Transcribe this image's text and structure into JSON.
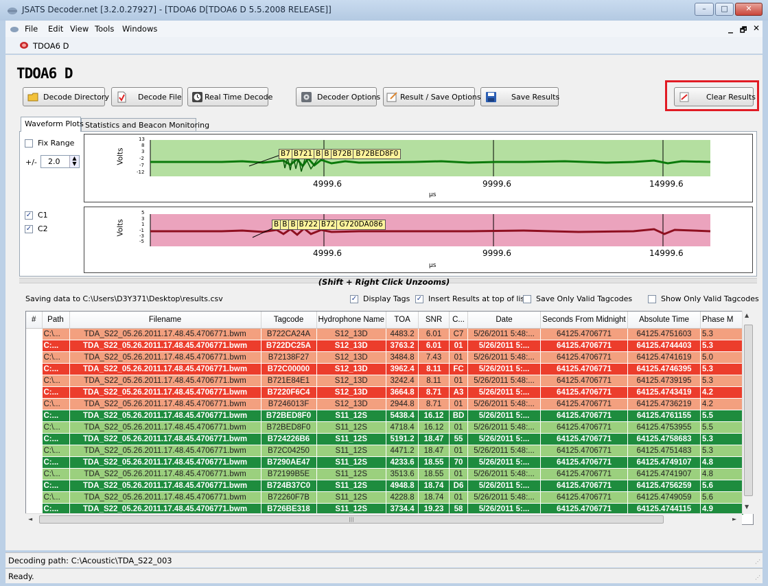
{
  "window": {
    "title": "JSATS Decoder.net [3.2.0.27927] - [TDOA6 D[TDOA6 D 5.5.2008 RELEASE]]",
    "minimize": "–",
    "maximize": "□",
    "close": "✕"
  },
  "menu": {
    "items": [
      "File",
      "Edit",
      "View",
      "Tools",
      "Windows"
    ],
    "mdi_minimize": "_",
    "mdi_restore": "🗗",
    "mdi_close": "✕"
  },
  "document_tab": {
    "title": "TDOA6 D"
  },
  "heading": "TDOA6 D",
  "toolbar": {
    "decode_directory": "Decode Directory",
    "decode_file": "Decode File",
    "real_time_decode": "Real Time Decode",
    "decoder_options": "Decoder Options",
    "result_save_options": "Result / Save Options",
    "save_results": "Save Results",
    "clear_results": "Clear Results"
  },
  "tabs": [
    "Waveform Plots",
    "Statistics and Beacon Monitoring"
  ],
  "controls": {
    "fix_range": "Fix Range",
    "plus_minus": "+/-",
    "range_value": "2.0",
    "c1": "C1",
    "c2": "C2"
  },
  "plot1": {
    "ylabel": "Volts",
    "xlabel": "µs",
    "yticks": [
      "13",
      "8",
      "3",
      "-2",
      "-7",
      "-12"
    ],
    "xticks": [
      "4999.6",
      "9999.6",
      "14999.6"
    ],
    "tags": [
      "B7",
      "B721",
      "B",
      "B",
      "B72B",
      "B72BED8F0"
    ],
    "color": "#00a000"
  },
  "plot2": {
    "ylabel": "Volts",
    "xlabel": "µs",
    "yticks": [
      "5",
      "3",
      "1",
      "-1",
      "-3",
      "-5"
    ],
    "xticks": [
      "4999.6",
      "9999.6",
      "14999.6"
    ],
    "tags": [
      "B",
      "B",
      "B",
      "B722",
      "B72",
      "G720DA086"
    ],
    "color": "#b0102a"
  },
  "unzoom_hint": "(Shift + Right Click Unzooms)",
  "options": {
    "saving_to": "Saving data to C:\\Users\\D3Y371\\Desktop\\results.csv",
    "display_tags": "Display Tags",
    "insert_top": "Insert Results at top of list",
    "save_only_valid": "Save Only Valid Tagcodes",
    "show_only_valid": "Show Only Valid Tagcodes"
  },
  "table": {
    "columns": [
      "#",
      "Path",
      "Filename",
      "Tagcode",
      "Hydrophone Name",
      "TOA",
      "SNR",
      "C...",
      "Date",
      "Seconds From Midnight",
      "Absolute Time",
      "Phase M"
    ],
    "rows": [
      {
        "style": "ls",
        "cells": [
          "",
          "C:\\...",
          "TDA_S22_05.26.2011.17.48.45.4706771.bwm",
          "B722CA24A",
          "S12_13D",
          "4483.2",
          "6.01",
          "C7",
          "5/26/2011 5:48:...",
          "64125.4706771",
          "64125.4751603",
          "5.3"
        ]
      },
      {
        "style": "ds",
        "cells": [
          "",
          "C:...",
          "TDA_S22_05.26.2011.17.48.45.4706771.bwm",
          "B722DC25A",
          "S12_13D",
          "3763.2",
          "6.01",
          "01",
          "5/26/2011 5:...",
          "64125.4706771",
          "64125.4744403",
          "5.3"
        ]
      },
      {
        "style": "ls",
        "cells": [
          "",
          "C:\\...",
          "TDA_S22_05.26.2011.17.48.45.4706771.bwm",
          "B72138F27",
          "S12_13D",
          "3484.8",
          "7.43",
          "01",
          "5/26/2011 5:48:...",
          "64125.4706771",
          "64125.4741619",
          "5.0"
        ]
      },
      {
        "style": "ds",
        "cells": [
          "",
          "C:...",
          "TDA_S22_05.26.2011.17.48.45.4706771.bwm",
          "B72C00000",
          "S12_13D",
          "3962.4",
          "8.11",
          "FC",
          "5/26/2011 5:...",
          "64125.4706771",
          "64125.4746395",
          "5.3"
        ]
      },
      {
        "style": "ls",
        "cells": [
          "",
          "C:\\...",
          "TDA_S22_05.26.2011.17.48.45.4706771.bwm",
          "B721E84E1",
          "S12_13D",
          "3242.4",
          "8.11",
          "01",
          "5/26/2011 5:48:...",
          "64125.4706771",
          "64125.4739195",
          "5.3"
        ]
      },
      {
        "style": "ds",
        "cells": [
          "",
          "C:...",
          "TDA_S22_05.26.2011.17.48.45.4706771.bwm",
          "B7220F6C4",
          "S12_13D",
          "3664.8",
          "8.71",
          "A3",
          "5/26/2011 5:...",
          "64125.4706771",
          "64125.4743419",
          "4.2"
        ]
      },
      {
        "style": "ls",
        "cells": [
          "",
          "C:\\...",
          "TDA_S22_05.26.2011.17.48.45.4706771.bwm",
          "B7246013F",
          "S12_13D",
          "2944.8",
          "8.71",
          "01",
          "5/26/2011 5:48:...",
          "64125.4706771",
          "64125.4736219",
          "4.2"
        ]
      },
      {
        "style": "dg",
        "cells": [
          "",
          "C:...",
          "TDA_S22_05.26.2011.17.48.45.4706771.bwm",
          "B72BED8F0",
          "S11_12S",
          "5438.4",
          "16.12",
          "BD",
          "5/26/2011 5:...",
          "64125.4706771",
          "64125.4761155",
          "5.5"
        ]
      },
      {
        "style": "lg",
        "cells": [
          "",
          "C:\\...",
          "TDA_S22_05.26.2011.17.48.45.4706771.bwm",
          "B72BED8F0",
          "S11_12S",
          "4718.4",
          "16.12",
          "01",
          "5/26/2011 5:48:...",
          "64125.4706771",
          "64125.4753955",
          "5.5"
        ]
      },
      {
        "style": "dg",
        "cells": [
          "",
          "C:...",
          "TDA_S22_05.26.2011.17.48.45.4706771.bwm",
          "B724226B6",
          "S11_12S",
          "5191.2",
          "18.47",
          "55",
          "5/26/2011 5:...",
          "64125.4706771",
          "64125.4758683",
          "5.3"
        ]
      },
      {
        "style": "lg",
        "cells": [
          "",
          "C:\\...",
          "TDA_S22_05.26.2011.17.48.45.4706771.bwm",
          "B72C04250",
          "S11_12S",
          "4471.2",
          "18.47",
          "01",
          "5/26/2011 5:48:...",
          "64125.4706771",
          "64125.4751483",
          "5.3"
        ]
      },
      {
        "style": "dg",
        "cells": [
          "",
          "C:...",
          "TDA_S22_05.26.2011.17.48.45.4706771.bwm",
          "B7290AE47",
          "S11_12S",
          "4233.6",
          "18.55",
          "70",
          "5/26/2011 5:...",
          "64125.4706771",
          "64125.4749107",
          "4.8"
        ]
      },
      {
        "style": "lg",
        "cells": [
          "",
          "C:\\...",
          "TDA_S22_05.26.2011.17.48.45.4706771.bwm",
          "B72199B5E",
          "S11_12S",
          "3513.6",
          "18.55",
          "01",
          "5/26/2011 5:48:...",
          "64125.4706771",
          "64125.4741907",
          "4.8"
        ]
      },
      {
        "style": "dg",
        "cells": [
          "",
          "C:...",
          "TDA_S22_05.26.2011.17.48.45.4706771.bwm",
          "B724B37C0",
          "S11_12S",
          "4948.8",
          "18.74",
          "D6",
          "5/26/2011 5:...",
          "64125.4706771",
          "64125.4756259",
          "5.6"
        ]
      },
      {
        "style": "lg",
        "cells": [
          "",
          "C:\\...",
          "TDA_S22_05.26.2011.17.48.45.4706771.bwm",
          "B72260F7B",
          "S11_12S",
          "4228.8",
          "18.74",
          "01",
          "5/26/2011 5:48:...",
          "64125.4706771",
          "64125.4749059",
          "5.6"
        ]
      },
      {
        "style": "dg",
        "cells": [
          "",
          "C:...",
          "TDA_S22_05.26.2011.17.48.45.4706771.bwm",
          "B726BE318",
          "S11_12S",
          "3734.4",
          "19.23",
          "58",
          "5/26/2011 5:...",
          "64125.4706771",
          "64125.4744115",
          "4.9"
        ]
      }
    ]
  },
  "colors": {
    "light_salmon": "#f3a07f",
    "dark_red": "#ec3d2c",
    "light_green": "#9bd07e",
    "dark_green": "#1e8c3e",
    "highlight": "#e11b24"
  },
  "scroll": {
    "h_grip": "|||",
    "up": "▲",
    "down": "▼",
    "left": "◄",
    "right": "►"
  },
  "status": {
    "decoding_path": "Decoding path: C:\\Acoustic\\TDA_S22_003",
    "ready": "Ready."
  }
}
